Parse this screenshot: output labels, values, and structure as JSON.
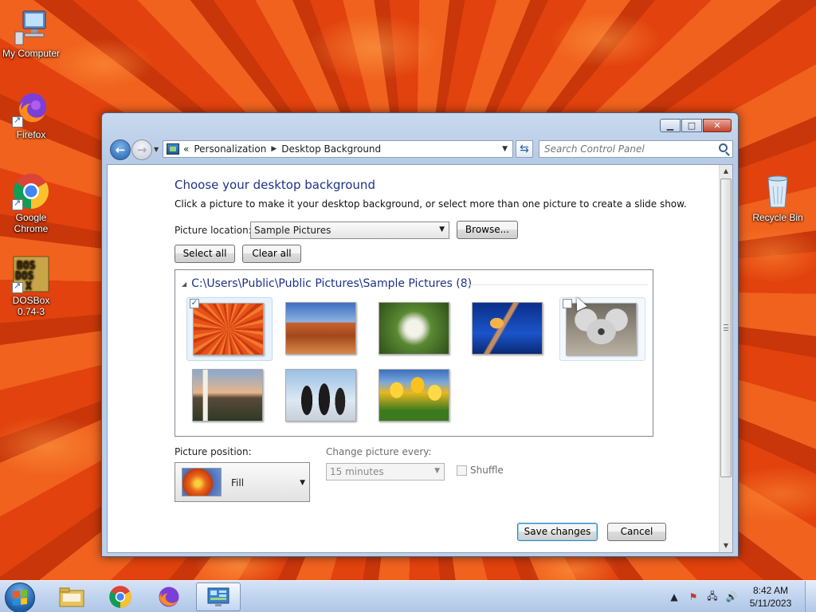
{
  "desktop": {
    "icons": [
      {
        "label": "My Computer",
        "icon": "computer-icon"
      },
      {
        "label": "Firefox",
        "icon": "firefox-icon"
      },
      {
        "label": "Google Chrome",
        "icon": "chrome-icon"
      },
      {
        "label": "DOSBox 0.74-3",
        "icon": "dosbox-icon",
        "glyph_text": "DOSBOX"
      },
      {
        "label": "Recycle Bin",
        "icon": "recycle-bin-icon"
      }
    ]
  },
  "window": {
    "breadcrumb": [
      "Personalization",
      "Desktop Background"
    ],
    "breadcrumb_prefix": "«",
    "search_placeholder": "Search Control Panel",
    "heading": "Choose your desktop background",
    "subtitle": "Click a picture to make it your desktop background, or select more than one picture to create a slide show.",
    "picture_location_label": "Picture location:",
    "picture_location_value": "Sample Pictures",
    "browse_label": "Browse...",
    "select_all_label": "Select all",
    "clear_all_label": "Clear all",
    "group_header": "C:\\Users\\Public\\Public Pictures\\Sample Pictures (8)",
    "pictures": [
      {
        "name": "chrysanthemum",
        "checked": true
      },
      {
        "name": "desert",
        "checked": false
      },
      {
        "name": "hydrangeas",
        "checked": false
      },
      {
        "name": "jellyfish",
        "checked": false
      },
      {
        "name": "koala",
        "checked": false
      },
      {
        "name": "lighthouse",
        "checked": false
      },
      {
        "name": "penguins",
        "checked": false
      },
      {
        "name": "tulips",
        "checked": false
      }
    ],
    "picture_position_label": "Picture position:",
    "picture_position_value": "Fill",
    "change_every_label": "Change picture every:",
    "change_every_value": "15 minutes",
    "shuffle_label": "Shuffle",
    "save_label": "Save changes",
    "cancel_label": "Cancel"
  },
  "taskbar": {
    "items": [
      "file-explorer-icon",
      "chrome-icon",
      "firefox-icon",
      "control-panel-icon"
    ],
    "time": "8:42 AM",
    "date": "5/11/2023"
  }
}
